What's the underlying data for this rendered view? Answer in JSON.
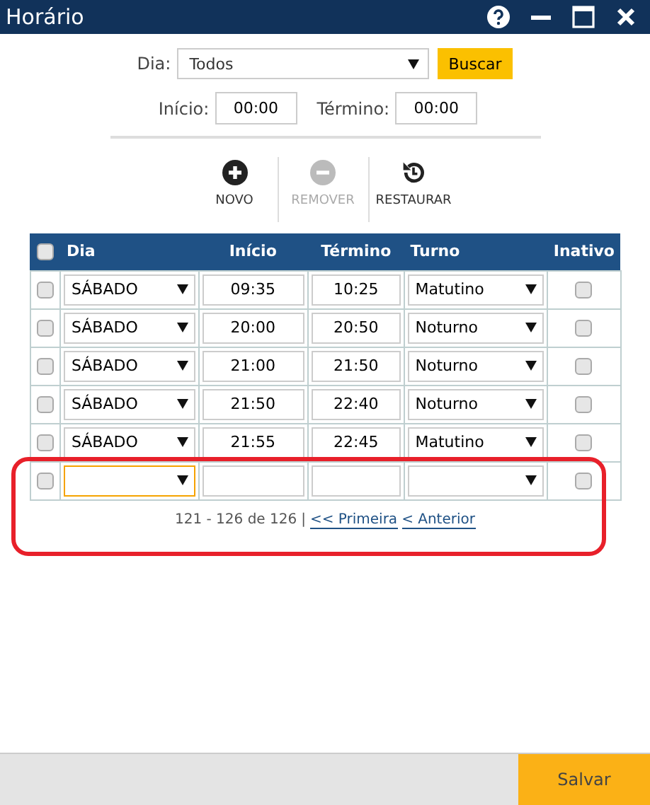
{
  "window": {
    "title": "Horário"
  },
  "filters": {
    "dia_label": "Dia:",
    "dia_value": "Todos",
    "search_button": "Buscar",
    "inicio_label": "Início:",
    "inicio_value": "00:00",
    "termino_label": "Término:",
    "termino_value": "00:00"
  },
  "toolbar": [
    {
      "kind": "add",
      "label": "NOVO",
      "disabled": false
    },
    {
      "kind": "remove",
      "label": "REMOVER",
      "disabled": true
    },
    {
      "kind": "restore",
      "label": "RESTAURAR",
      "disabled": false
    }
  ],
  "table": {
    "select_all": false,
    "columns": [
      "Dia",
      "Início",
      "Término",
      "Turno",
      "Inativo"
    ],
    "rows": [
      {
        "checked": false,
        "dia": "SÁBADO",
        "inicio": "09:35",
        "termino": "10:25",
        "turno": "Matutino",
        "inativo": false,
        "focused": false
      },
      {
        "checked": false,
        "dia": "SÁBADO",
        "inicio": "20:00",
        "termino": "20:50",
        "turno": "Noturno",
        "inativo": false,
        "focused": false
      },
      {
        "checked": false,
        "dia": "SÁBADO",
        "inicio": "21:00",
        "termino": "21:50",
        "turno": "Noturno",
        "inativo": false,
        "focused": false
      },
      {
        "checked": false,
        "dia": "SÁBADO",
        "inicio": "21:50",
        "termino": "22:40",
        "turno": "Noturno",
        "inativo": false,
        "focused": false
      },
      {
        "checked": false,
        "dia": "SÁBADO",
        "inicio": "21:55",
        "termino": "22:45",
        "turno": "Matutino",
        "inativo": false,
        "focused": false
      },
      {
        "checked": false,
        "inativo": false,
        "focused": true
      }
    ]
  },
  "pagination": {
    "range": "121 - 126 de 126",
    "separator": "|",
    "links": [
      "<< Primeira",
      "< Anterior"
    ]
  },
  "highlight": {
    "shown": true
  },
  "footer": {
    "save_button": "Salvar"
  }
}
